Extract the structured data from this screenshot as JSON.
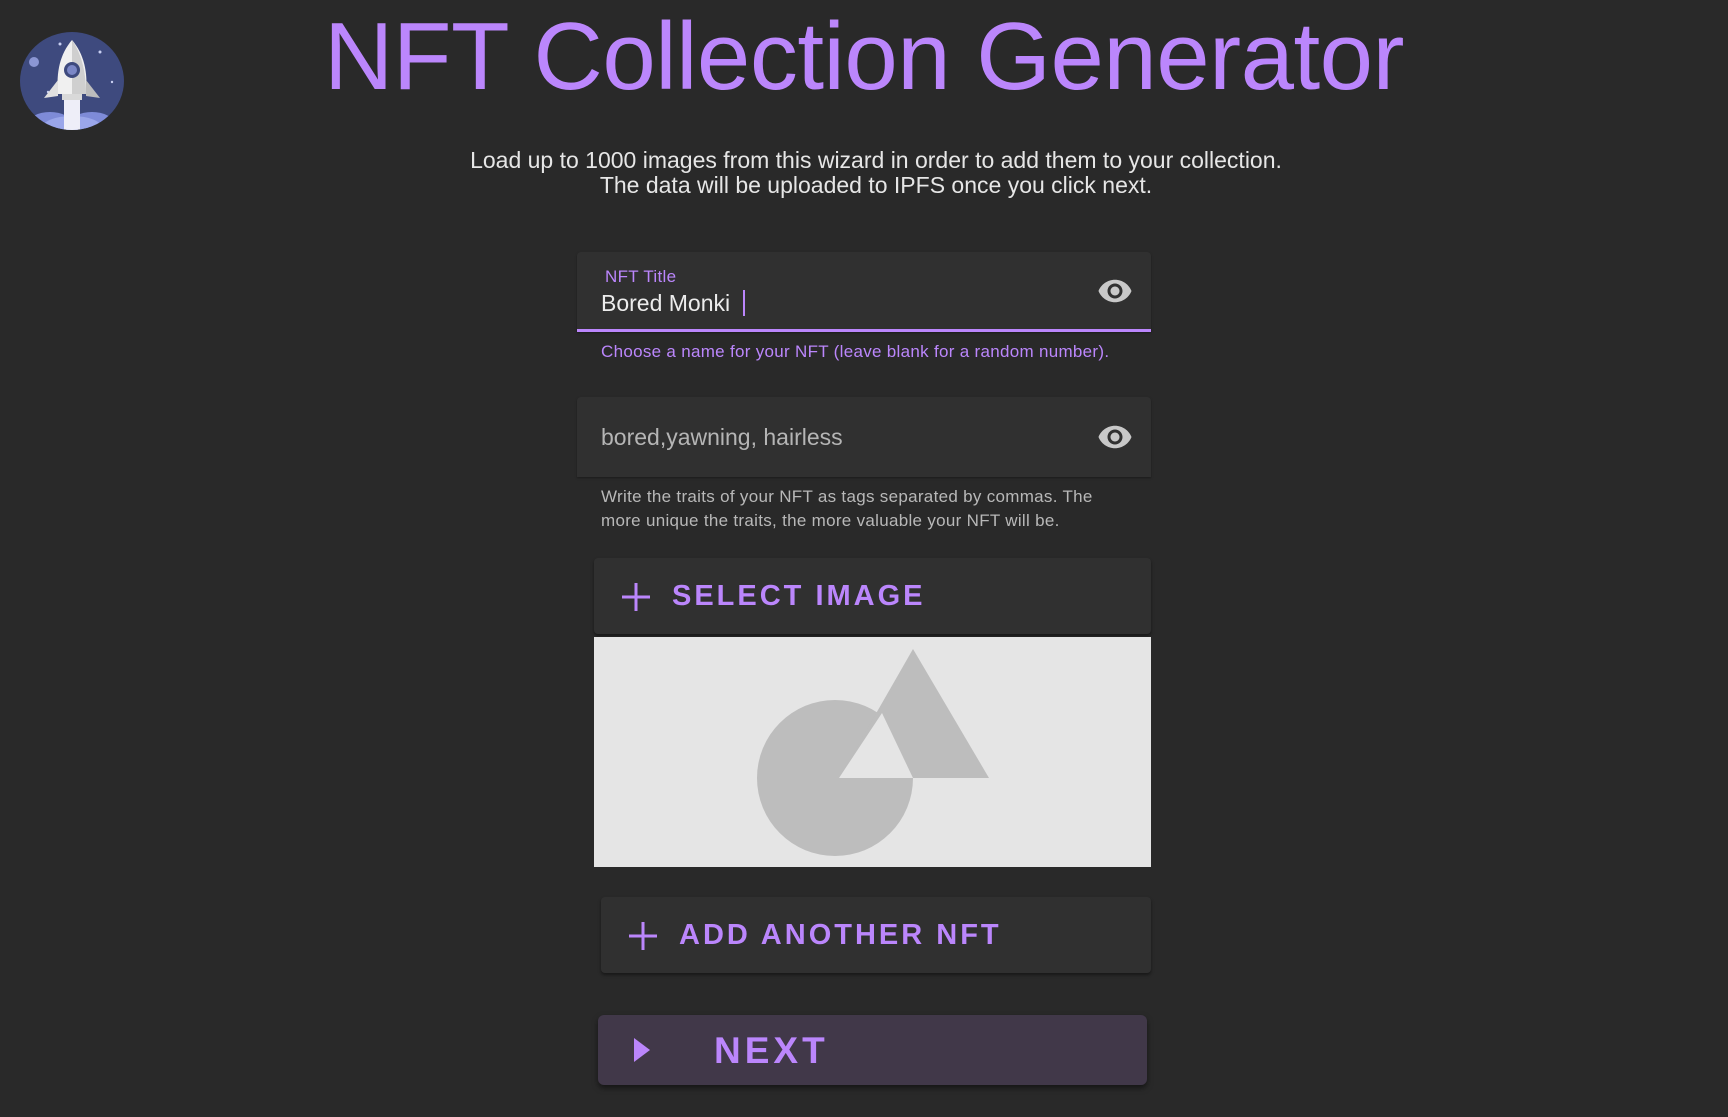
{
  "header": {
    "title": "NFT Collection Generator",
    "logo_icon": "rocket-icon"
  },
  "intro": {
    "line1": "Load up to 1000 images from this wizard in order to add them to your collection.",
    "line2": "The data will be uploaded to IPFS once you click next."
  },
  "form": {
    "title_field": {
      "label": "NFT Title",
      "value": "Bored Monki",
      "hint": "Choose a name for your NFT (leave blank for a random number).",
      "icon": "eye-icon"
    },
    "traits_field": {
      "value": "bored,yawning, hairless",
      "hint": "Write the traits of your NFT as tags separated by commas. The more unique the traits, the more valuable your NFT will be.",
      "icon": "eye-icon"
    },
    "select_image_label": "SELECT IMAGE",
    "image_placeholder_icon": "image-placeholder-icon",
    "add_another_label": "ADD ANOTHER NFT",
    "next_label": "NEXT"
  },
  "colors": {
    "background": "#292929",
    "accent": "#bb86fc",
    "surface": "#303030",
    "next_button": "#413849"
  }
}
